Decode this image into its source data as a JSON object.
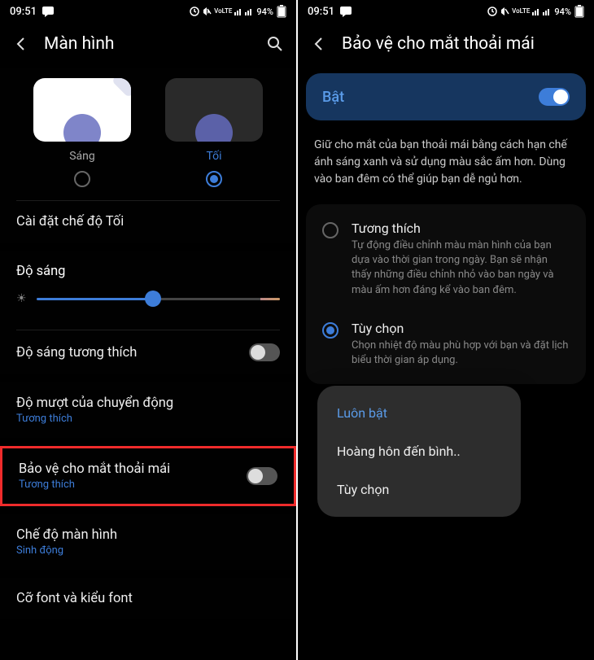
{
  "status": {
    "time": "09:51",
    "battery": "94%",
    "volte": "VoLTE"
  },
  "left": {
    "header": "Màn hình",
    "theme": {
      "light": "Sáng",
      "dark": "Tối"
    },
    "dark_settings": "Cài đặt chế độ Tối",
    "brightness": "Độ sáng",
    "adaptive_brightness": "Độ sáng tương thích",
    "motion": {
      "title": "Độ mượt của chuyển động",
      "sub": "Tương thích"
    },
    "eye_comfort": {
      "title": "Bảo vệ cho mắt thoải mái",
      "sub": "Tương thích"
    },
    "screen_mode": {
      "title": "Chế độ màn hình",
      "sub": "Sinh động"
    },
    "font": "Cỡ font và kiểu font"
  },
  "right": {
    "header": "Bảo vệ cho mắt thoải mái",
    "enable": "Bật",
    "desc": "Giữ cho mắt của bạn thoải mái bằng cách hạn chế ánh sáng xanh và sử dụng màu sắc ấm hơn. Dùng vào ban đêm có thể giúp bạn dễ ngủ hơn.",
    "opt1": {
      "title": "Tương thích",
      "desc": "Tự động điều chỉnh màu màn hình của bạn dựa vào thời gian trong ngày. Bạn sẽ nhận thấy những điều chỉnh nhỏ vào ban ngày và màu ấm hơn đáng kể vào ban đêm."
    },
    "opt2": {
      "title": "Tùy chọn",
      "desc": "Chọn nhiệt độ màu phù hợp với bạn và đặt lịch biểu thời gian áp dụng."
    },
    "popup": {
      "always": "Luôn bật",
      "sunset": "Hoàng hôn đến bình..",
      "custom": "Tùy chọn"
    }
  }
}
